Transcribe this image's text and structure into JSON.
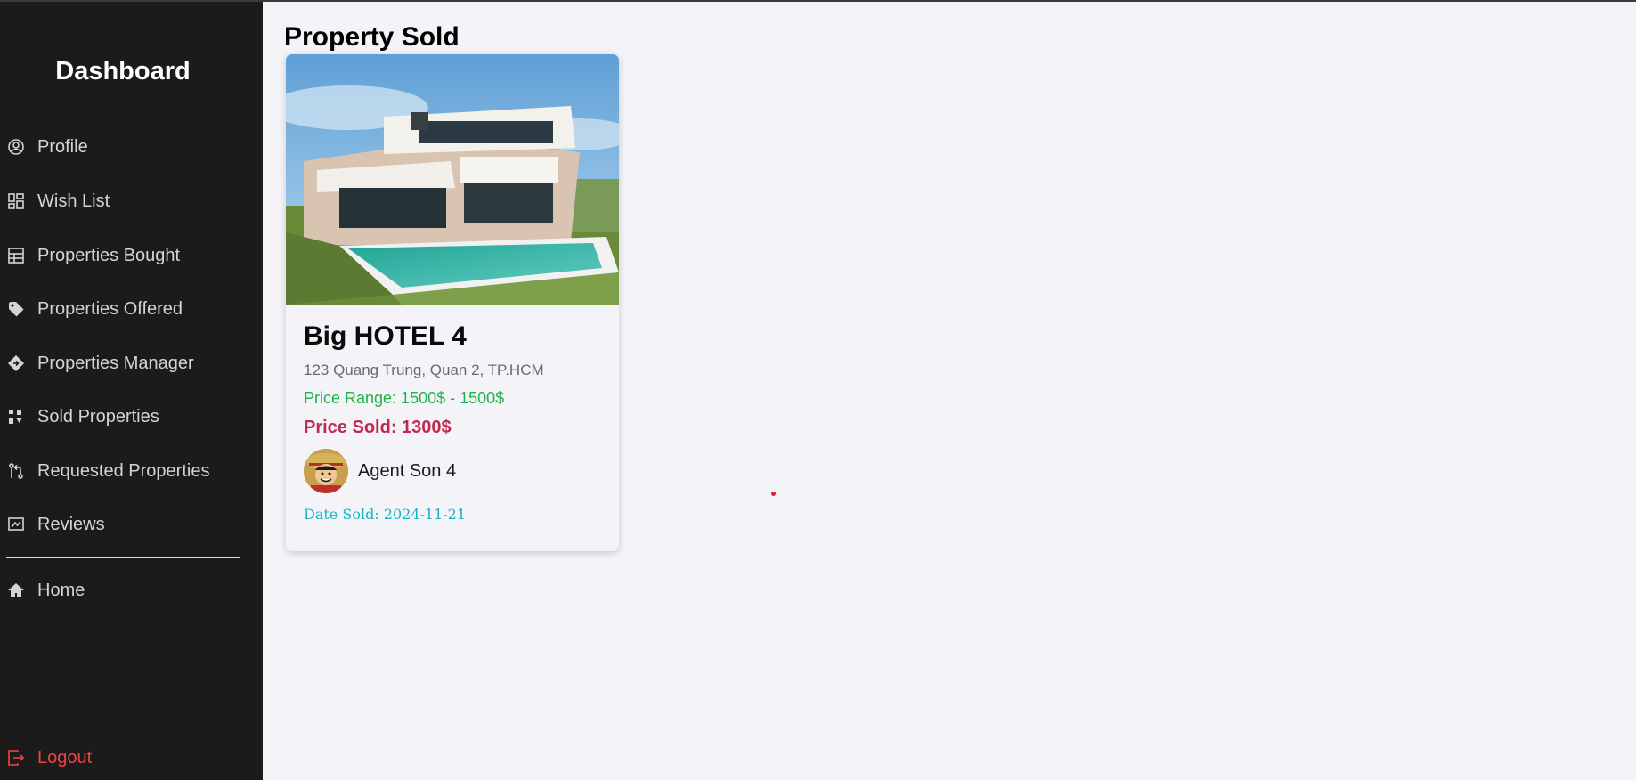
{
  "sidebar": {
    "brand": "Dashboard",
    "items": [
      {
        "label": "Profile",
        "icon": "user-circle-icon"
      },
      {
        "label": "Wish List",
        "icon": "dashboard-grid-icon"
      },
      {
        "label": "Properties Bought",
        "icon": "table-icon"
      },
      {
        "label": "Properties Offered",
        "icon": "tag-icon"
      },
      {
        "label": "Properties Manager",
        "icon": "diamond-icon"
      },
      {
        "label": "Sold Properties",
        "icon": "sort-icon"
      },
      {
        "label": "Requested Properties",
        "icon": "git-pull-icon"
      },
      {
        "label": "Reviews",
        "icon": "review-icon"
      }
    ],
    "home_label": "Home",
    "logout_label": "Logout"
  },
  "main": {
    "title": "Property Sold",
    "cards": [
      {
        "name": "Big HOTEL 4",
        "address": "123 Quang Trung, Quan 2, TP.HCM",
        "price_range": "Price Range: 1500$ - 1500$",
        "price_sold": "Price Sold: 1300$",
        "agent_name": "Agent Son 4",
        "date_sold": "Date Sold: 2024-11-21"
      }
    ]
  },
  "colors": {
    "sidebar_bg": "#1b1b1b",
    "page_bg": "#f4f3f8",
    "range_green": "#22b24c",
    "sold_red": "#c0284f",
    "date_cyan": "#17b3c6",
    "logout_red": "#ef4444"
  }
}
